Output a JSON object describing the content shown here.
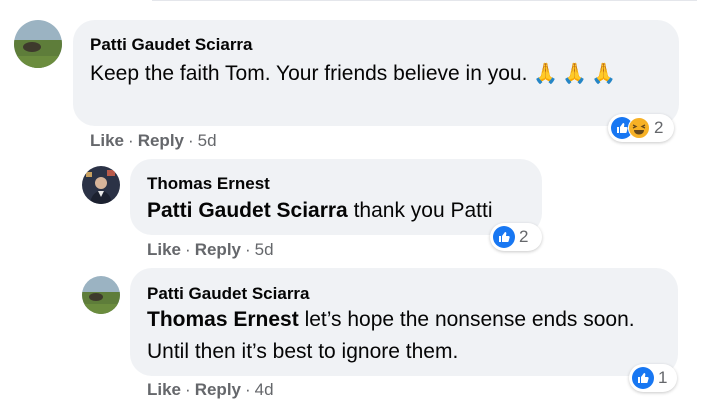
{
  "comments": [
    {
      "author": "Patti Gaudet Sciarra",
      "mention": "",
      "text": "Keep the faith Tom. Your friends believe in you.",
      "emoji": "🙏🙏🙏",
      "actions": {
        "like": "Like",
        "reply": "Reply",
        "time": "5d"
      },
      "reactions": {
        "icons": [
          "like-icon",
          "haha-icon"
        ],
        "count": "2"
      }
    },
    {
      "author": "Thomas Ernest",
      "mention": "Patti Gaudet Sciarra",
      "text": "thank you Patti",
      "actions": {
        "like": "Like",
        "reply": "Reply",
        "time": "5d"
      },
      "reactions": {
        "icons": [
          "like-icon"
        ],
        "count": "2"
      }
    },
    {
      "author": "Patti Gaudet Sciarra",
      "mention": "Thomas Ernest",
      "text": "let’s hope the nonsense ends soon. Until then it’s best to ignore them.",
      "actions": {
        "like": "Like",
        "reply": "Reply",
        "time": "4d"
      },
      "reactions": {
        "icons": [
          "like-icon"
        ],
        "count": "1"
      }
    }
  ],
  "separator": "·",
  "colors": {
    "bubble": "#f0f2f5",
    "meta": "#65676b",
    "like_blue": "#1877f2",
    "haha_yellow": "#f7b125"
  }
}
